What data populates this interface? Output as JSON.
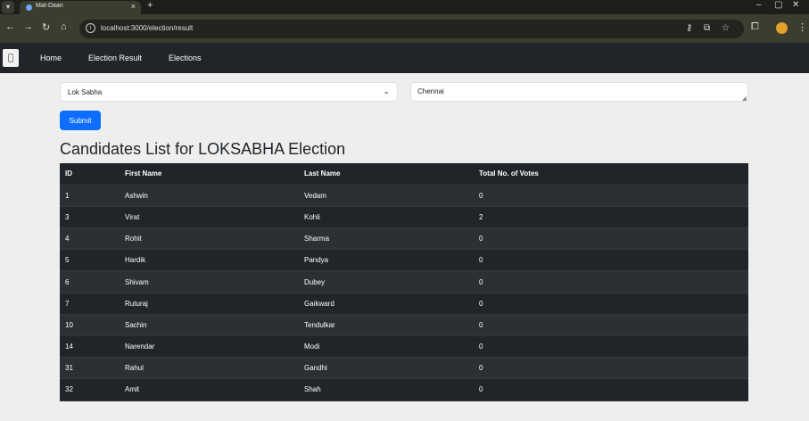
{
  "browser": {
    "tab_title": "Mat-Daan",
    "url": "localhost:3000/election/result"
  },
  "nav": {
    "home": "Home",
    "election_result": "Election Result",
    "elections": "Elections"
  },
  "form": {
    "election_type": "Lok Sabha",
    "constituency": "Chennai",
    "submit_label": "Submit"
  },
  "heading": "Candidates List for LOKSABHA Election",
  "table": {
    "headers": [
      "ID",
      "First Name",
      "Last Name",
      "Total No. of Votes"
    ],
    "rows": [
      [
        "1",
        "Ashwin",
        "Vedam",
        "0"
      ],
      [
        "3",
        "Virat",
        "Kohli",
        "2"
      ],
      [
        "4",
        "Rohit",
        "Sharma",
        "0"
      ],
      [
        "5",
        "Hardik",
        "Pandya",
        "0"
      ],
      [
        "6",
        "Shivam",
        "Dubey",
        "0"
      ],
      [
        "7",
        "Ruturaj",
        "Gaikward",
        "0"
      ],
      [
        "10",
        "Sachin",
        "Tendulkar",
        "0"
      ],
      [
        "14",
        "Narendar",
        "Modi",
        "0"
      ],
      [
        "31",
        "Rahul",
        "Gandhi",
        "0"
      ],
      [
        "32",
        "Amit",
        "Shah",
        "0"
      ]
    ]
  },
  "colors": {
    "primary": "#0d6efd",
    "navbar": "#212529",
    "table_dark": "#212529",
    "table_stripe": "#2c3034"
  },
  "icons": [
    "back-icon",
    "forward-icon",
    "reload-icon",
    "home-icon",
    "site-info-icon",
    "password-key-icon",
    "cast-icon",
    "star-icon",
    "extensions-icon",
    "menu-dots-icon"
  ]
}
